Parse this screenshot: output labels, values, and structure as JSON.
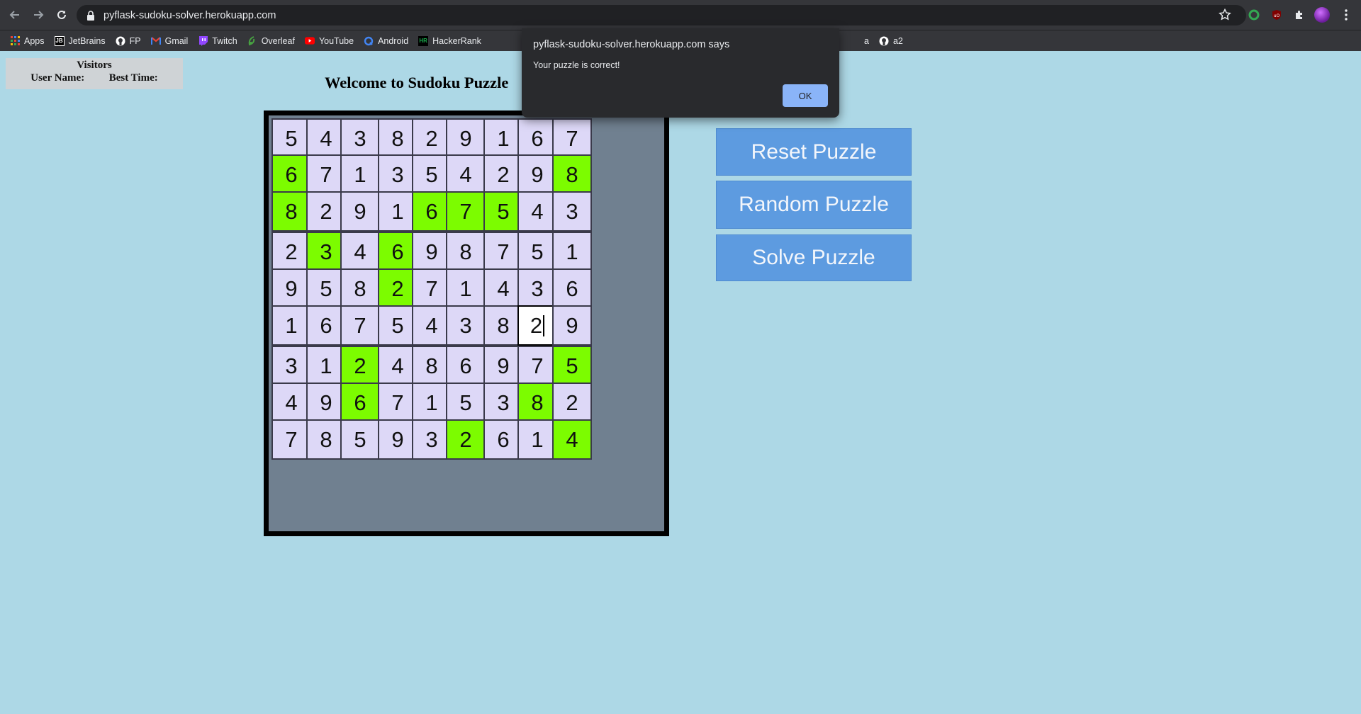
{
  "browser": {
    "url": "pyflask-sudoku-solver.herokuapp.com",
    "bookmarks": [
      {
        "label": "Apps",
        "icon": "apps-grid-icon",
        "color": "#ea4335"
      },
      {
        "label": "JetBrains",
        "icon": "jetbrains-icon",
        "color": "#ffffff"
      },
      {
        "label": "FP",
        "icon": "github-icon",
        "color": "#ffffff"
      },
      {
        "label": "Gmail",
        "icon": "gmail-icon",
        "color": "#ea4335"
      },
      {
        "label": "Twitch",
        "icon": "twitch-icon",
        "color": "#9146ff"
      },
      {
        "label": "Overleaf",
        "icon": "overleaf-icon",
        "color": "#47a141"
      },
      {
        "label": "YouTube",
        "icon": "youtube-icon",
        "color": "#ff0000"
      },
      {
        "label": "Android",
        "icon": "android-icon",
        "color": "#4285f4"
      },
      {
        "label": "HackerRank",
        "icon": "hackerrank-icon",
        "color": "#1ba94c"
      }
    ],
    "bookmarks_right": [
      {
        "label": "a",
        "icon": "bookmark-icon"
      },
      {
        "label": "a2",
        "icon": "github-icon"
      }
    ]
  },
  "visitors": {
    "title": "Visitors",
    "col_user": "User Name:",
    "col_time": "Best Time:"
  },
  "page_title": "Welcome to Sudoku Puzzle",
  "board": {
    "rows": [
      [
        "5",
        "4",
        "3",
        "8",
        "2",
        "9",
        "1",
        "6",
        "7"
      ],
      [
        "6",
        "7",
        "1",
        "3",
        "5",
        "4",
        "2",
        "9",
        "8"
      ],
      [
        "8",
        "2",
        "9",
        "1",
        "6",
        "7",
        "5",
        "4",
        "3"
      ],
      [
        "2",
        "3",
        "4",
        "6",
        "9",
        "8",
        "7",
        "5",
        "1"
      ],
      [
        "9",
        "5",
        "8",
        "2",
        "7",
        "1",
        "4",
        "3",
        "6"
      ],
      [
        "1",
        "6",
        "7",
        "5",
        "4",
        "3",
        "8",
        "2",
        "9"
      ],
      [
        "3",
        "1",
        "2",
        "4",
        "8",
        "6",
        "9",
        "7",
        "5"
      ],
      [
        "4",
        "9",
        "6",
        "7",
        "1",
        "5",
        "3",
        "8",
        "2"
      ],
      [
        "7",
        "8",
        "5",
        "9",
        "3",
        "2",
        "6",
        "1",
        "4"
      ]
    ],
    "given": [
      [
        0,
        0,
        0,
        0,
        0,
        0,
        0,
        0,
        0
      ],
      [
        1,
        0,
        0,
        0,
        0,
        0,
        0,
        0,
        1
      ],
      [
        1,
        0,
        0,
        0,
        1,
        1,
        1,
        0,
        0
      ],
      [
        0,
        1,
        0,
        1,
        0,
        0,
        0,
        0,
        0
      ],
      [
        0,
        0,
        0,
        1,
        0,
        0,
        0,
        0,
        0
      ],
      [
        0,
        0,
        0,
        0,
        0,
        0,
        0,
        0,
        0
      ],
      [
        0,
        0,
        1,
        0,
        0,
        0,
        0,
        0,
        1
      ],
      [
        0,
        0,
        1,
        0,
        0,
        0,
        0,
        1,
        0
      ],
      [
        0,
        0,
        0,
        0,
        0,
        1,
        0,
        0,
        1
      ]
    ],
    "active_cell": {
      "row": 5,
      "col": 7
    },
    "given_color": "#7cfc00",
    "cell_color": "#ddd8f7"
  },
  "buttons": {
    "reset": "Reset Puzzle",
    "random": "Random Puzzle",
    "solve": "Solve Puzzle"
  },
  "dialog": {
    "title": "pyflask-sudoku-solver.herokuapp.com says",
    "message": "Your puzzle is correct!",
    "ok": "OK"
  }
}
